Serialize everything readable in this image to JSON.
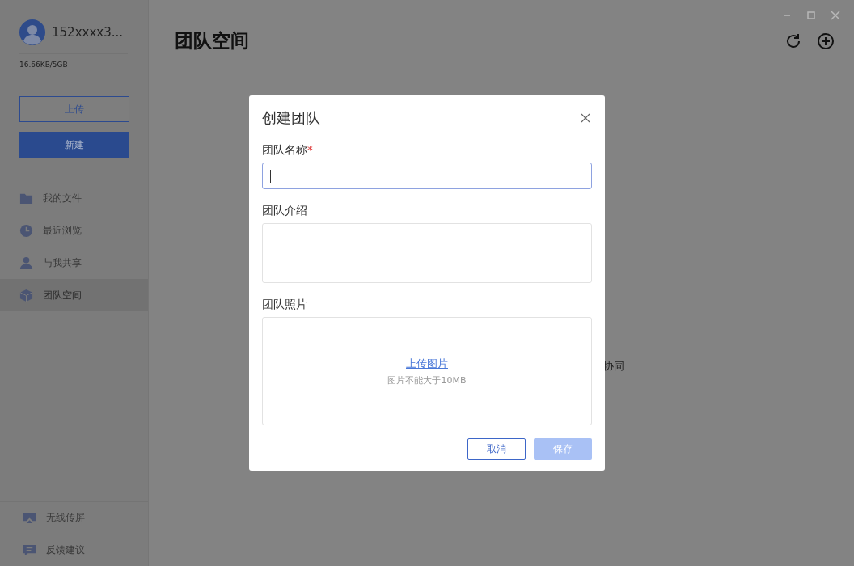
{
  "user": {
    "name": "152xxxx3...",
    "storage": "16.66KB/5GB"
  },
  "sidebar": {
    "upload_button": "上传",
    "new_button": "新建",
    "items": [
      {
        "label": "我的文件",
        "selected": false
      },
      {
        "label": "最近浏览",
        "selected": false
      },
      {
        "label": "与我共享",
        "selected": false
      },
      {
        "label": "团队空间",
        "selected": true
      }
    ],
    "footer": [
      {
        "label": "无线传屏"
      },
      {
        "label": "反馈建议"
      }
    ]
  },
  "main": {
    "title": "团队空间",
    "background_text": "协同"
  },
  "dialog": {
    "title": "创建团队",
    "name_field": {
      "label": "团队名称",
      "required_mark": "*",
      "focused": true
    },
    "intro_field": {
      "label": "团队介绍"
    },
    "photo_field": {
      "label": "团队照片",
      "link": "上传图片",
      "hint": "图片不能大于10MB"
    },
    "buttons": [
      {
        "label": "取消",
        "kind": "secondary",
        "disabled": false
      },
      {
        "label": "保存",
        "kind": "primary",
        "disabled": true
      }
    ]
  }
}
